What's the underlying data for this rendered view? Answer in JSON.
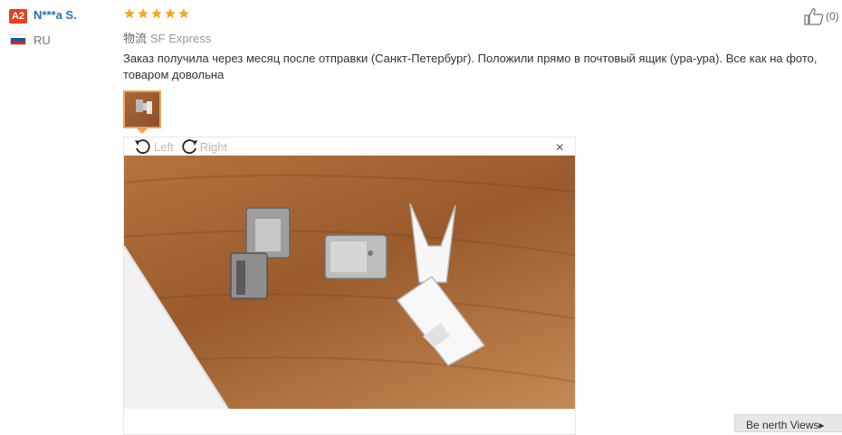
{
  "reviewer": {
    "badge": "A2",
    "name": "N***a S.",
    "country": "RU",
    "flag_colors": [
      "#ffffff",
      "#1c57a7",
      "#d52b1e"
    ]
  },
  "rating": {
    "value": 5,
    "max": 5,
    "star_color": "#f5a623"
  },
  "shipping": {
    "label": "物流",
    "method": "SF Express"
  },
  "review_text": "Заказ получила через месяц после отправки (Санкт-Петербург). Положили прямо в почтовый ящик (ура-ура). Все как на фото, товаром довольна",
  "helpful": {
    "icon": "thumbs-up-icon",
    "count": "(0)"
  },
  "viewer": {
    "rotate_left": "Left",
    "rotate_right": "Right",
    "close": "×"
  },
  "bottom_button": "Be nerth Views▸"
}
